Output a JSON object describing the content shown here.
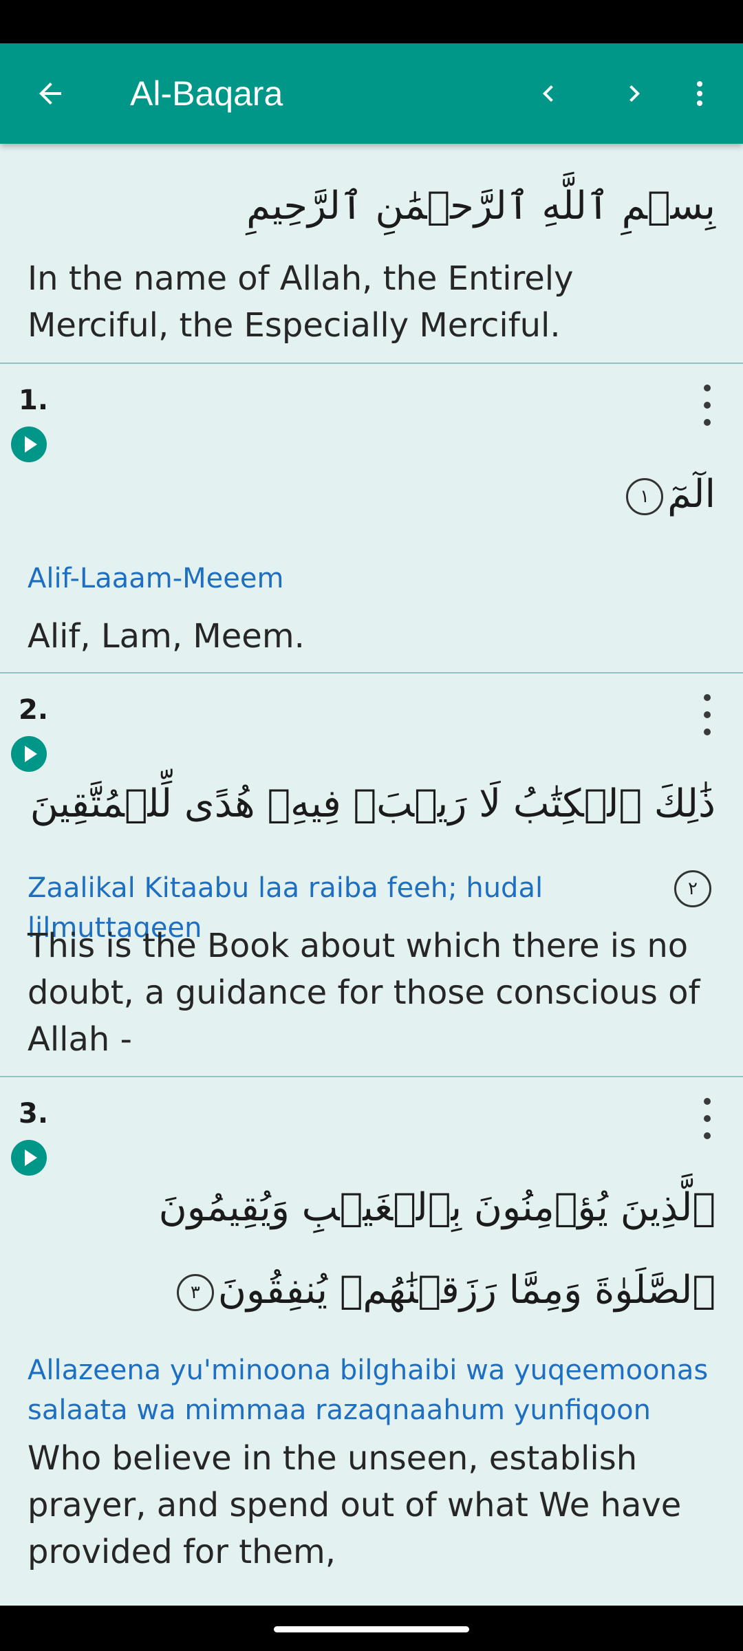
{
  "app_bar": {
    "title": "Al-Baqara"
  },
  "bismillah": {
    "arabic": "بِسۡمِ ٱللَّهِ ٱلرَّحۡمَٰنِ ٱلرَّحِيمِ",
    "translation": "In the name of Allah, the Entirely Merciful, the Especially Merciful."
  },
  "verses": [
    {
      "number": "1.",
      "arabic": "الٓمٓ",
      "ayah_mark": "١",
      "transliteration": "Alif-Laaam-Meeem",
      "translation": "Alif, Lam, Meem."
    },
    {
      "number": "2.",
      "arabic": "ذَٰلِكَ ٱلۡكِتَٰبُ لَا رَيۡبَۛ فِيهِۛ هُدًى لِّلۡمُتَّقِينَ",
      "ayah_mark": "٢",
      "transliteration": "Zaalikal Kitaabu laa raiba feeh; hudal lilmuttaqeen",
      "translation": "This is the Book about which there is no doubt, a guidance for those conscious of Allah -"
    },
    {
      "number": "3.",
      "arabic": "ٱلَّذِينَ يُؤۡمِنُونَ بِٱلۡغَيۡبِ وَيُقِيمُونَ ٱلصَّلَوٰةَ وَمِمَّا رَزَقۡنَٰهُمۡ يُنفِقُونَ",
      "ayah_mark": "٣",
      "transliteration": "Allazeena yu'minoona bilghaibi wa yuqeemoonas salaata wa mimmaa razaqnaahum yunfiqoon",
      "translation": "Who believe in the unseen, establish prayer, and spend out of what We have provided for them,"
    }
  ],
  "colors": {
    "primary": "#009688",
    "background": "#e3f2f1",
    "transliteration": "#1e6fc2"
  }
}
